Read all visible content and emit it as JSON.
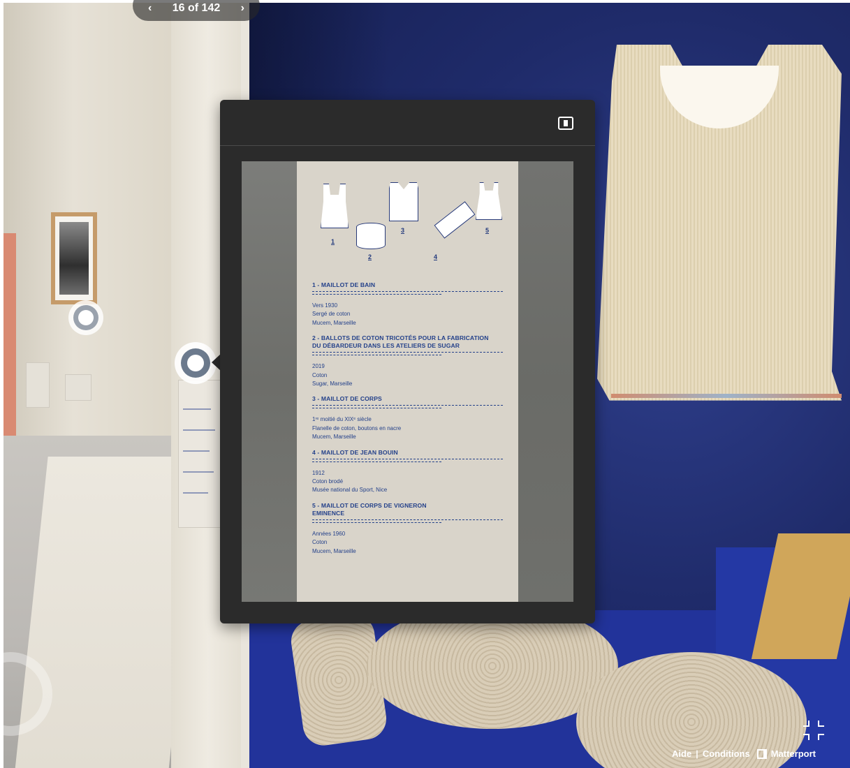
{
  "tour": {
    "position_counter": "16 of 142",
    "prev_icon": "chevron-left-icon",
    "next_icon": "chevron-right-icon"
  },
  "popup": {
    "expand_icon": "expand-panel-icon",
    "document": {
      "figure_numbers": [
        "1",
        "2",
        "3",
        "4",
        "5"
      ],
      "entries": [
        {
          "title": "1 - MAILLOT DE BAIN",
          "title_line2": "",
          "lines": [
            "Vers 1930",
            "Sergé de coton",
            "Mucem, Marseille"
          ]
        },
        {
          "title": "2 - BALLOTS DE COTON TRICOTÉS POUR LA FABRICATION",
          "title_line2": "DU DÉBARDEUR DANS LES ATELIERS DE SUGAR",
          "lines": [
            "2019",
            "Coton",
            "Sugar, Marseille"
          ]
        },
        {
          "title": "3 - MAILLOT DE CORPS",
          "title_line2": "",
          "lines": [
            "1ʳᵉ moitié du XIXᵉ siècle",
            "Flanelle de coton, boutons en nacre",
            "Mucem, Marseille"
          ]
        },
        {
          "title": "4 - MAILLOT DE JEAN BOUIN",
          "title_line2": "",
          "lines": [
            "1912",
            "Coton brodé",
            "Musée national du Sport, Nice"
          ]
        },
        {
          "title": "5 - MAILLOT DE CORPS DE VIGNERON",
          "title_line2": "EMINENCE",
          "lines": [
            "Années 1960",
            "Coton",
            "Mucem, Marseille"
          ]
        }
      ]
    }
  },
  "footer": {
    "help_label": "Aide",
    "separator": "|",
    "terms_label": "Conditions",
    "brand_label": "Matterport",
    "fullscreen_icon": "exit-fullscreen-icon"
  },
  "colors": {
    "popup_background": "#2b2b2b",
    "document_text": "#24418a",
    "document_paper": "#d9d4ca"
  }
}
